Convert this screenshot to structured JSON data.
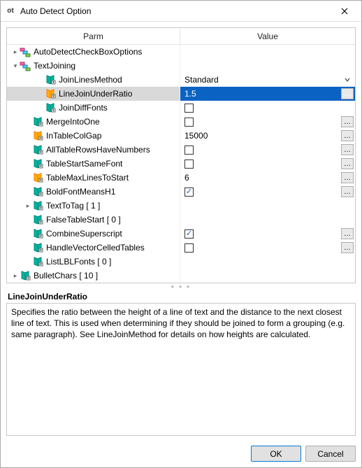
{
  "window": {
    "title": "Auto Detect Option"
  },
  "headers": {
    "parm": "Parm",
    "value": "Value"
  },
  "rows": [
    {
      "id": "autoDetect",
      "indent": 0,
      "expander": "closed",
      "icon": "group",
      "label": "AutoDetectCheckBoxOptions",
      "value": null,
      "btn": null
    },
    {
      "id": "textJoining",
      "indent": 0,
      "expander": "open",
      "icon": "group",
      "label": "TextJoining",
      "value": null,
      "btn": null
    },
    {
      "id": "joinLinesMethod",
      "indent": 2,
      "expander": "none",
      "icon": "leaf",
      "label": "JoinLinesMethod",
      "value": {
        "type": "text",
        "text": "Standard"
      },
      "btn": "dropdown"
    },
    {
      "id": "lineJoinUnderRatio",
      "indent": 2,
      "expander": "none",
      "icon": "leafsel",
      "label": "LineJoinUnderRatio",
      "value": {
        "type": "text",
        "text": "1.5"
      },
      "btn": "dots",
      "selected": true
    },
    {
      "id": "joinDiffFonts",
      "indent": 2,
      "expander": "none",
      "icon": "leaf",
      "label": "JoinDiffFonts",
      "value": {
        "type": "check",
        "checked": false
      },
      "btn": null
    },
    {
      "id": "mergeIntoOne",
      "indent": 1,
      "expander": "none",
      "icon": "leaf2",
      "label": "MergeIntoOne",
      "value": {
        "type": "check",
        "checked": false
      },
      "btn": "dots"
    },
    {
      "id": "inTableColGap",
      "indent": 1,
      "expander": "none",
      "icon": "leafsel",
      "label": "InTableColGap",
      "value": {
        "type": "text",
        "text": "15000"
      },
      "btn": "dots"
    },
    {
      "id": "allTableRowsHaveNumbers",
      "indent": 1,
      "expander": "none",
      "icon": "leaf2",
      "label": "AllTableRowsHaveNumbers",
      "value": {
        "type": "check",
        "checked": false
      },
      "btn": "dots"
    },
    {
      "id": "tableStartSameFont",
      "indent": 1,
      "expander": "none",
      "icon": "leaf2",
      "label": "TableStartSameFont",
      "value": {
        "type": "check",
        "checked": false
      },
      "btn": "dots"
    },
    {
      "id": "tableMaxLinesToStart",
      "indent": 1,
      "expander": "none",
      "icon": "leafsel",
      "label": "TableMaxLinesToStart",
      "value": {
        "type": "text",
        "text": "6"
      },
      "btn": "dots"
    },
    {
      "id": "boldFontMeansH1",
      "indent": 1,
      "expander": "none",
      "icon": "leaf2",
      "label": "BoldFontMeansH1",
      "value": {
        "type": "check",
        "checked": true
      },
      "btn": "dots"
    },
    {
      "id": "textToTag",
      "indent": 1,
      "expander": "closed",
      "icon": "leaf2",
      "label": "TextToTag [ 1 ]",
      "value": null,
      "btn": null
    },
    {
      "id": "falseTableStart",
      "indent": 1,
      "expander": "none",
      "icon": "leaf2",
      "label": "FalseTableStart [ 0 ]",
      "value": null,
      "btn": null
    },
    {
      "id": "combineSuperscript",
      "indent": 1,
      "expander": "none",
      "icon": "leaf2",
      "label": "CombineSuperscript",
      "value": {
        "type": "check",
        "checked": true
      },
      "btn": "dots"
    },
    {
      "id": "handleVectorCelledTables",
      "indent": 1,
      "expander": "none",
      "icon": "leaf2",
      "label": "HandleVectorCelledTables",
      "value": {
        "type": "check",
        "checked": false
      },
      "btn": "dots"
    },
    {
      "id": "listLBLFonts",
      "indent": 1,
      "expander": "none",
      "icon": "leaf2",
      "label": "ListLBLFonts [ 0 ]",
      "value": null,
      "btn": null
    },
    {
      "id": "bulletChars",
      "indent": 0,
      "expander": "closed",
      "icon": "leaf2",
      "label": "BulletChars [ 10 ]",
      "value": null,
      "btn": null
    }
  ],
  "description": {
    "title": "LineJoinUnderRatio",
    "body": "Specifies the ratio between the height of a line of text and the distance to the next closest line of text.  This is used when determining if they should be joined to form a grouping (e.g. same paragraph).  See LineJoinMethod for details on how heights are calculated."
  },
  "buttons": {
    "ok": "OK",
    "cancel": "Cancel"
  }
}
